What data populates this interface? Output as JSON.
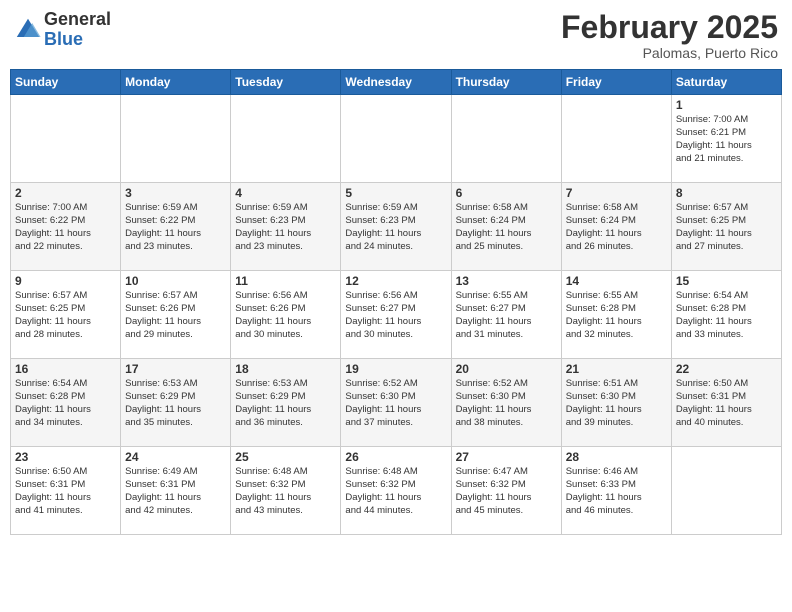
{
  "header": {
    "logo_general": "General",
    "logo_blue": "Blue",
    "month_title": "February 2025",
    "subtitle": "Palomas, Puerto Rico"
  },
  "days_of_week": [
    "Sunday",
    "Monday",
    "Tuesday",
    "Wednesday",
    "Thursday",
    "Friday",
    "Saturday"
  ],
  "weeks": [
    [
      {
        "day": "",
        "info": ""
      },
      {
        "day": "",
        "info": ""
      },
      {
        "day": "",
        "info": ""
      },
      {
        "day": "",
        "info": ""
      },
      {
        "day": "",
        "info": ""
      },
      {
        "day": "",
        "info": ""
      },
      {
        "day": "1",
        "info": "Sunrise: 7:00 AM\nSunset: 6:21 PM\nDaylight: 11 hours\nand 21 minutes."
      }
    ],
    [
      {
        "day": "2",
        "info": "Sunrise: 7:00 AM\nSunset: 6:22 PM\nDaylight: 11 hours\nand 22 minutes."
      },
      {
        "day": "3",
        "info": "Sunrise: 6:59 AM\nSunset: 6:22 PM\nDaylight: 11 hours\nand 23 minutes."
      },
      {
        "day": "4",
        "info": "Sunrise: 6:59 AM\nSunset: 6:23 PM\nDaylight: 11 hours\nand 23 minutes."
      },
      {
        "day": "5",
        "info": "Sunrise: 6:59 AM\nSunset: 6:23 PM\nDaylight: 11 hours\nand 24 minutes."
      },
      {
        "day": "6",
        "info": "Sunrise: 6:58 AM\nSunset: 6:24 PM\nDaylight: 11 hours\nand 25 minutes."
      },
      {
        "day": "7",
        "info": "Sunrise: 6:58 AM\nSunset: 6:24 PM\nDaylight: 11 hours\nand 26 minutes."
      },
      {
        "day": "8",
        "info": "Sunrise: 6:57 AM\nSunset: 6:25 PM\nDaylight: 11 hours\nand 27 minutes."
      }
    ],
    [
      {
        "day": "9",
        "info": "Sunrise: 6:57 AM\nSunset: 6:25 PM\nDaylight: 11 hours\nand 28 minutes."
      },
      {
        "day": "10",
        "info": "Sunrise: 6:57 AM\nSunset: 6:26 PM\nDaylight: 11 hours\nand 29 minutes."
      },
      {
        "day": "11",
        "info": "Sunrise: 6:56 AM\nSunset: 6:26 PM\nDaylight: 11 hours\nand 30 minutes."
      },
      {
        "day": "12",
        "info": "Sunrise: 6:56 AM\nSunset: 6:27 PM\nDaylight: 11 hours\nand 30 minutes."
      },
      {
        "day": "13",
        "info": "Sunrise: 6:55 AM\nSunset: 6:27 PM\nDaylight: 11 hours\nand 31 minutes."
      },
      {
        "day": "14",
        "info": "Sunrise: 6:55 AM\nSunset: 6:28 PM\nDaylight: 11 hours\nand 32 minutes."
      },
      {
        "day": "15",
        "info": "Sunrise: 6:54 AM\nSunset: 6:28 PM\nDaylight: 11 hours\nand 33 minutes."
      }
    ],
    [
      {
        "day": "16",
        "info": "Sunrise: 6:54 AM\nSunset: 6:28 PM\nDaylight: 11 hours\nand 34 minutes."
      },
      {
        "day": "17",
        "info": "Sunrise: 6:53 AM\nSunset: 6:29 PM\nDaylight: 11 hours\nand 35 minutes."
      },
      {
        "day": "18",
        "info": "Sunrise: 6:53 AM\nSunset: 6:29 PM\nDaylight: 11 hours\nand 36 minutes."
      },
      {
        "day": "19",
        "info": "Sunrise: 6:52 AM\nSunset: 6:30 PM\nDaylight: 11 hours\nand 37 minutes."
      },
      {
        "day": "20",
        "info": "Sunrise: 6:52 AM\nSunset: 6:30 PM\nDaylight: 11 hours\nand 38 minutes."
      },
      {
        "day": "21",
        "info": "Sunrise: 6:51 AM\nSunset: 6:30 PM\nDaylight: 11 hours\nand 39 minutes."
      },
      {
        "day": "22",
        "info": "Sunrise: 6:50 AM\nSunset: 6:31 PM\nDaylight: 11 hours\nand 40 minutes."
      }
    ],
    [
      {
        "day": "23",
        "info": "Sunrise: 6:50 AM\nSunset: 6:31 PM\nDaylight: 11 hours\nand 41 minutes."
      },
      {
        "day": "24",
        "info": "Sunrise: 6:49 AM\nSunset: 6:31 PM\nDaylight: 11 hours\nand 42 minutes."
      },
      {
        "day": "25",
        "info": "Sunrise: 6:48 AM\nSunset: 6:32 PM\nDaylight: 11 hours\nand 43 minutes."
      },
      {
        "day": "26",
        "info": "Sunrise: 6:48 AM\nSunset: 6:32 PM\nDaylight: 11 hours\nand 44 minutes."
      },
      {
        "day": "27",
        "info": "Sunrise: 6:47 AM\nSunset: 6:32 PM\nDaylight: 11 hours\nand 45 minutes."
      },
      {
        "day": "28",
        "info": "Sunrise: 6:46 AM\nSunset: 6:33 PM\nDaylight: 11 hours\nand 46 minutes."
      },
      {
        "day": "",
        "info": ""
      }
    ]
  ]
}
